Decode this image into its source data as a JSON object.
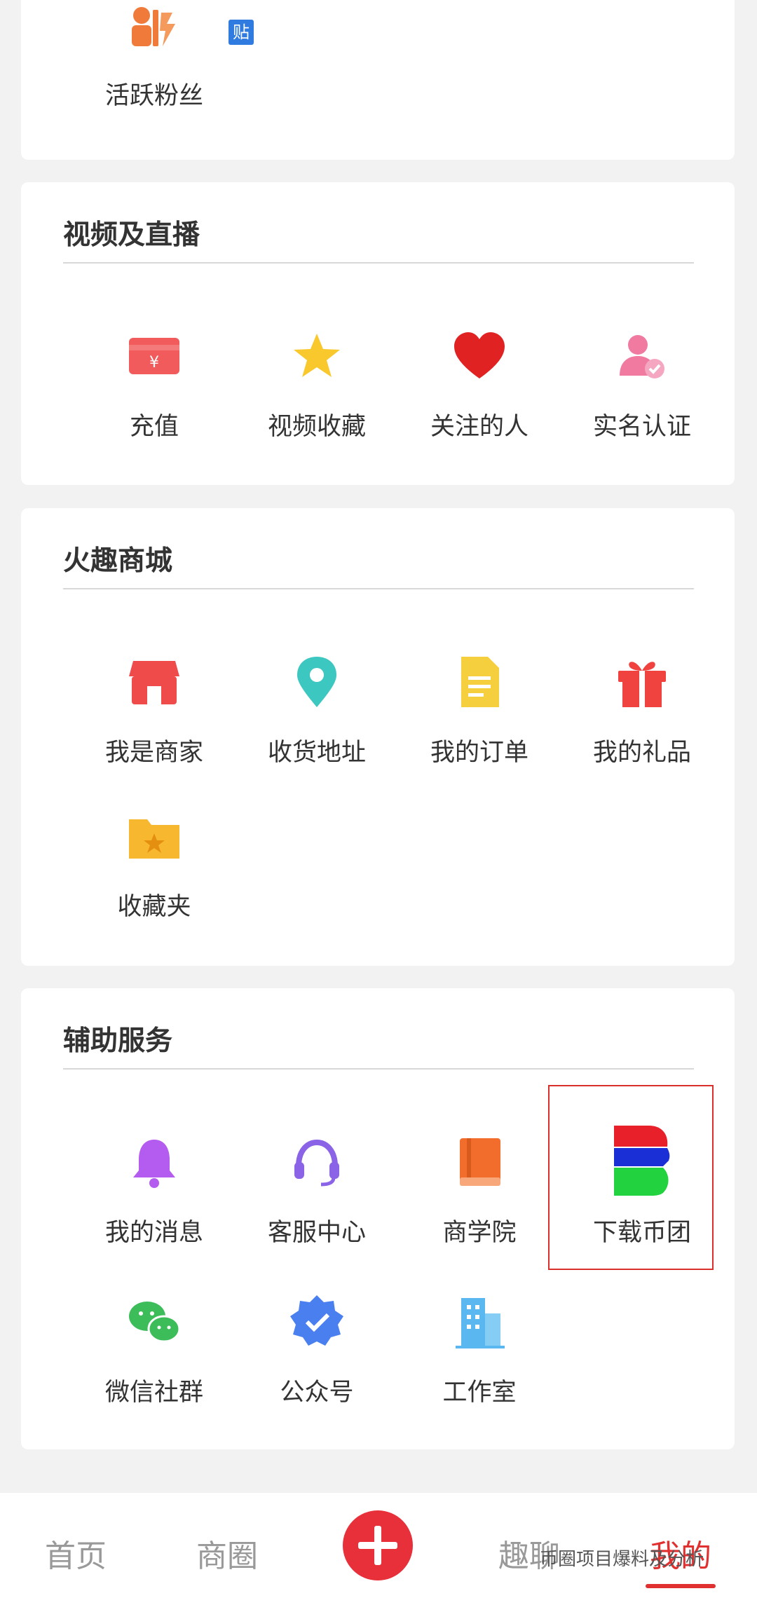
{
  "top_section": {
    "fans": {
      "label": "活跃粉丝",
      "icon": "active-fans-icon",
      "color": "#f07a3a"
    },
    "sticker": {
      "label": "贴",
      "icon": "post-badge-icon",
      "color": "#2f7be0"
    }
  },
  "video_section": {
    "title": "视频及直播",
    "items": [
      {
        "label": "充值",
        "icon": "recharge-card-icon",
        "color": "#f25b5b"
      },
      {
        "label": "视频收藏",
        "icon": "star-icon",
        "color": "#f9c82d"
      },
      {
        "label": "关注的人",
        "icon": "heart-icon",
        "color": "#e02222"
      },
      {
        "label": "实名认证",
        "icon": "verified-user-icon",
        "color": "#f07aa0"
      }
    ]
  },
  "mall_section": {
    "title": "火趣商城",
    "items": [
      {
        "label": "我是商家",
        "icon": "shop-icon",
        "color": "#f04b4b"
      },
      {
        "label": "收货地址",
        "icon": "location-pin-icon",
        "color": "#3cc7c0"
      },
      {
        "label": "我的订单",
        "icon": "document-icon",
        "color": "#f6cf3e"
      },
      {
        "label": "我的礼品",
        "icon": "gift-icon",
        "color": "#f0423f"
      },
      {
        "label": "收藏夹",
        "icon": "folder-star-icon",
        "color": "#f7b830"
      }
    ]
  },
  "service_section": {
    "title": "辅助服务",
    "items": [
      {
        "label": "我的消息",
        "icon": "bell-icon",
        "color": "#b45cf0"
      },
      {
        "label": "客服中心",
        "icon": "headset-icon",
        "color": "#8a63e6"
      },
      {
        "label": "商学院",
        "icon": "book-icon",
        "color": "#f26d2b"
      },
      {
        "label": "下载币团",
        "icon": "bitun-logo-icon",
        "highlighted": true
      },
      {
        "label": "微信社群",
        "icon": "wechat-icon",
        "color": "#3dbd5a"
      },
      {
        "label": "公众号",
        "icon": "verified-badge-icon",
        "color": "#4a7ff0"
      },
      {
        "label": "工作室",
        "icon": "building-icon",
        "color": "#5bb7f0"
      }
    ]
  },
  "bottom_nav": {
    "items": [
      {
        "label": "首页"
      },
      {
        "label": "商圈"
      },
      {
        "label": "趣聊"
      },
      {
        "label": "我的",
        "active": true
      }
    ],
    "add_icon": "plus-icon"
  },
  "watermark": {
    "text": "币圈项目爆料及分析"
  },
  "colors": {
    "accent": "#e03030",
    "background": "#f2f2f2",
    "card": "#ffffff"
  }
}
